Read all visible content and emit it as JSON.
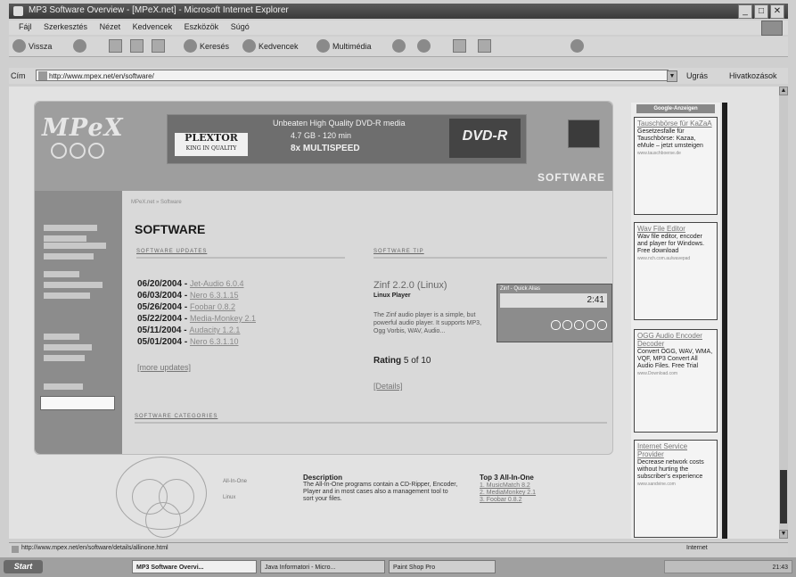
{
  "window": {
    "title": "MP3 Software Overview - [MPeX.net] - Microsoft Internet Explorer",
    "min_label": "_",
    "max_label": "□",
    "close_label": "✕"
  },
  "menubar": {
    "items": [
      "Fájl",
      "Szerkesztés",
      "Nézet",
      "Kedvencek",
      "Eszközök",
      "Súgó"
    ]
  },
  "toolbar": {
    "back_label": "Vissza",
    "search_label": "Keresés",
    "favorites_label": "Kedvencek",
    "media_label": "Multimédia"
  },
  "addressbar": {
    "label": "Cím",
    "url": "http://www.mpex.net/en/software/",
    "go_label": "Ugrás",
    "links_label": "Hivatkozások"
  },
  "site": {
    "logo": "MPeX",
    "banner": {
      "line1": "Unbeaten High Quality DVD-R media",
      "line2": "4.7 GB - 120 min",
      "line3": "8x MULTISPEED",
      "brand": "PLEXTOR",
      "brand_tagline": "KING IN QUALITY",
      "dvd": "DVD-R"
    },
    "section_title": "SOFTWARE",
    "breadcrumb": "MPeX.net » Software",
    "page_title": "SOFTWARE",
    "updates_heading": "SOFTWARE UPDATES",
    "tip_heading": "SOFTWARE TIP",
    "updates": [
      {
        "date": "06/20/2004",
        "name": "Jet-Audio 6.0.4"
      },
      {
        "date": "06/03/2004",
        "name": "Nero 6.3.1.15"
      },
      {
        "date": "05/26/2004",
        "name": "Foobar 0.8.2"
      },
      {
        "date": "05/22/2004",
        "name": "Media-Monkey 2.1"
      },
      {
        "date": "05/11/2004",
        "name": "Audacity 1.2.1"
      },
      {
        "date": "05/01/2004",
        "name": "Nero 6.3.1.10"
      }
    ],
    "all_updates": "[more updates]",
    "tip": {
      "title": "Zinf 2.2.0 (Linux)",
      "subtitle": "Linux Player",
      "description": "The Zinf audio player is a simple, but powerful audio player. It supports MP3, Ogg Vorbis, WAV, Audio...",
      "rating_label": "Rating",
      "rating_value": "5 of 10",
      "details": "[Details]",
      "player_title": "Zinf - Quick Alias",
      "player_time": "2:41"
    },
    "categories_heading": "SOFTWARE CATEGORIES",
    "allinone": {
      "icon1": "All-In-One",
      "icon2": "Linux",
      "desc_title": "Description",
      "desc_text": "The All-In-One programs contain a CD-Ripper, Encoder, Player and in most cases also a management tool to sort your files.",
      "top3_title": "Top 3 All-In-One",
      "top3": [
        "1. MusicMatch 8.2",
        "2. MediaMonkey 2.1",
        "3. Foobar 0.8.2"
      ]
    }
  },
  "right_ads": {
    "heading": "Google-Anzeigen",
    "ads": [
      {
        "title": "Tauschbörse für KaZaA",
        "text": "Gesetzesfalle für Tauschbörse: Kazaa, eMule – jetzt umsteigen",
        "url": "www.tauschboerse.de"
      },
      {
        "title": "Wav File Editor",
        "text": "Wav file editor, encoder and player for Windows. Free download",
        "url": "www.nch.com.au/wavepad"
      },
      {
        "title": "OGG Audio Encoder Decoder",
        "text": "Convert OGG, WAV, WMA, VQF, MP3 Convert All Audio Files. Free Trial",
        "url": "www.Download.com"
      },
      {
        "title": "Internet Service Provider",
        "text": "Decrease network costs without hurting the subscriber's experience",
        "url": "www.sandvine.com"
      }
    ]
  },
  "statusbar": {
    "text": "http://www.mpex.net/en/software/details/allinone.html",
    "zone": "Internet"
  },
  "taskbar": {
    "start": "Start",
    "tasks": [
      "MP3 Software Overvi...",
      "Java Informatori - Micro...",
      "Paint Shop Pro"
    ],
    "clock": "21:43"
  }
}
